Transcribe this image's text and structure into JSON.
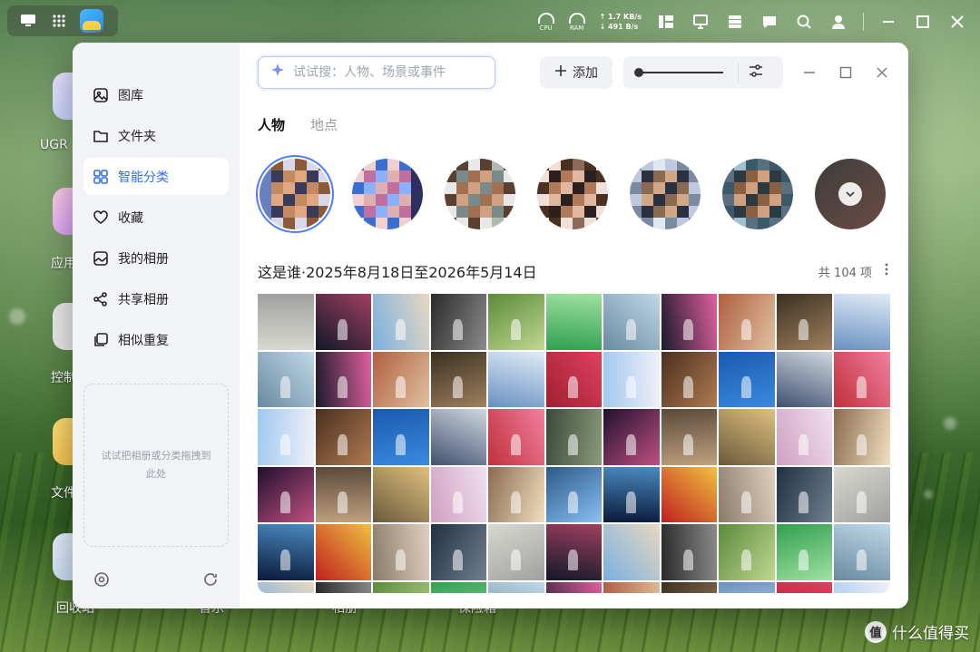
{
  "desktop": {
    "labels": [
      "UGR",
      "应用",
      "控制",
      "文件",
      "回收站",
      "音乐",
      "相册",
      "保险箱"
    ],
    "status": {
      "cpu_label": "CPU",
      "ram_label": "RAM",
      "upload": "↑ 1.7 KB/s",
      "download": "↓ 491 B/s"
    },
    "watermark": "什么值得买"
  },
  "sidebar": {
    "items": [
      {
        "label": "图库",
        "icon": "gallery-icon"
      },
      {
        "label": "文件夹",
        "icon": "folder-icon"
      },
      {
        "label": "智能分类",
        "icon": "smart-category-icon"
      },
      {
        "label": "收藏",
        "icon": "heart-icon"
      },
      {
        "label": "我的相册",
        "icon": "album-icon"
      },
      {
        "label": "共享相册",
        "icon": "share-icon"
      },
      {
        "label": "相似重复",
        "icon": "duplicate-icon"
      }
    ],
    "active_index": 2,
    "dropzone_text": "试试把相册或分类拖拽到此处"
  },
  "toolbar": {
    "search_placeholder": "试试搜：人物、场景或事件",
    "add_label": "添加",
    "zoom_level": 0.0
  },
  "tabs": [
    {
      "label": "人物",
      "active": true
    },
    {
      "label": "地点",
      "active": false
    }
  ],
  "people": {
    "count_visible": 6,
    "selected_index": 0
  },
  "section": {
    "title": "这是谁·2025年8月18日至2026年5月14日",
    "count": "共 104 项"
  },
  "colors": {
    "accent": "#2f6bff",
    "sidebar_bg": "#f1f3f7"
  }
}
